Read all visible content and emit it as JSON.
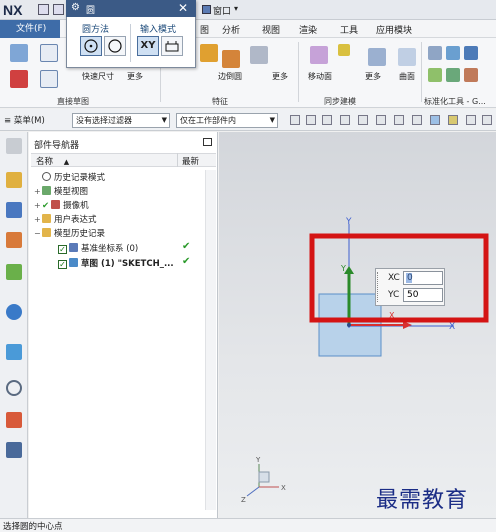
{
  "app": {
    "logo": "NX",
    "window_menu": "窗口",
    "quick_access_more": "▾"
  },
  "menu": {
    "file": "文件(F)",
    "items": [
      "图",
      "分析",
      "视图",
      "渲染",
      "工具",
      "应用模块"
    ]
  },
  "ribbon": {
    "quick_dimension": "快速尺寸",
    "more1": "更多",
    "edge_curve": "边倒圆",
    "more2": "更多",
    "move_face": "移动面",
    "more3": "更多",
    "surface": "曲面",
    "group_direct_sketch": "直接草图",
    "group_feature": "特征",
    "group_sync": "同步建模",
    "group_std": "标准化工具 - G..."
  },
  "filterbar": {
    "menu": "菜单(M)",
    "filter": "没有选择过滤器",
    "scope": "仅在工作部件内"
  },
  "navigator": {
    "title": "部件导航器",
    "col_name": "名称",
    "col_latest": "最新",
    "rows": [
      {
        "label": "历史记录模式"
      },
      {
        "label": "模型视图"
      },
      {
        "label": "摄像机"
      },
      {
        "label": "用户表达式"
      },
      {
        "label": "模型历史记录"
      },
      {
        "label": "基准坐标系 (0)"
      },
      {
        "label": "草图 (1) \"SKETCH_..."
      }
    ]
  },
  "dialog": {
    "title": "圆",
    "section_method": "圆方法",
    "section_input": "输入模式",
    "xy_label": "XY"
  },
  "coord_input": {
    "xc_label": "XC",
    "xc_value": "0",
    "yc_label": "YC",
    "yc_value": "50"
  },
  "axes": {
    "x_label": "X",
    "y_label": "Y",
    "z_label": "Z"
  },
  "status": {
    "text": "选择圆的中心点"
  },
  "watermark": "最需教育",
  "colors": {
    "file_menu": "#3e6ca8",
    "dialog_title": "#3b5a86",
    "highlight_box": "#d41414",
    "watermark": "#1b2d86"
  }
}
